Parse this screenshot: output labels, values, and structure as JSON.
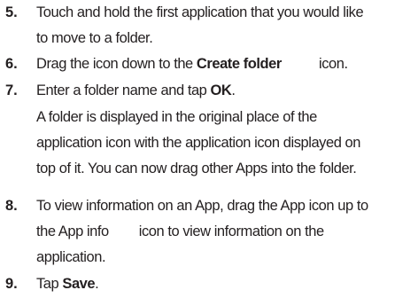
{
  "steps": [
    {
      "number": "5.",
      "lines": [
        "Touch and hold the first application that you would like",
        "to move to a folder."
      ]
    },
    {
      "number": "6.",
      "prefix": "Drag the icon down to the ",
      "bold": "Create folder",
      "suffix": " icon."
    },
    {
      "number": "7.",
      "prefix": "Enter a folder name and tap ",
      "bold": "OK",
      "suffix": "."
    },
    {
      "note_lines": [
        "A folder is displayed in the original place of the",
        "application icon with the application icon displayed on",
        "top of it. You can now drag other Apps into the folder."
      ]
    },
    {
      "number": "8.",
      "lines": [
        "To view information on an App, drag the App icon up to",
        "the App info",
        "icon to view information on the",
        "application."
      ]
    },
    {
      "number": "9.",
      "prefix": "Tap ",
      "bold": "Save",
      "suffix": "."
    }
  ]
}
